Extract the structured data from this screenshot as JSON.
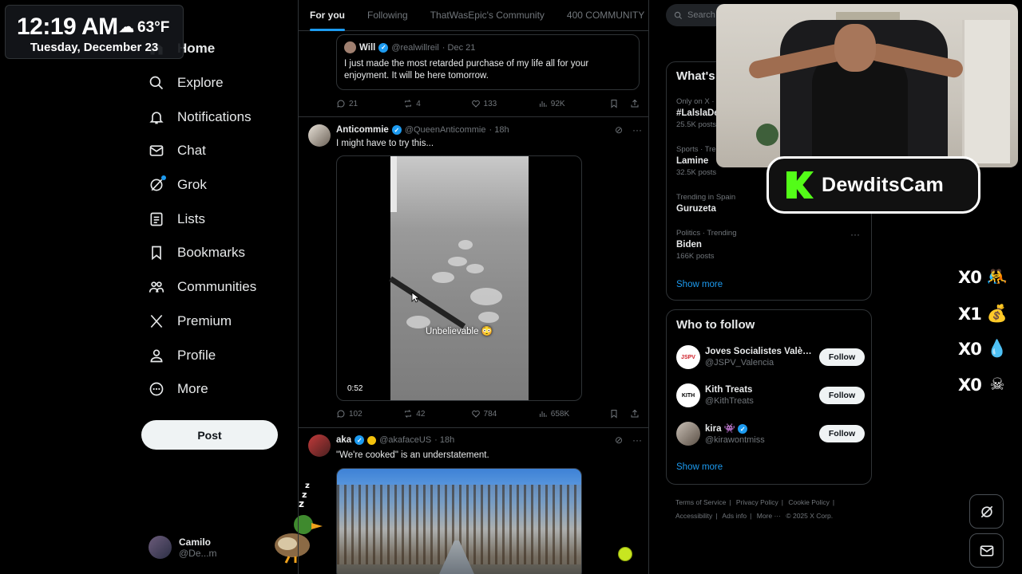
{
  "overlay_clock": {
    "time": "12:19 AM",
    "temperature": "63°F",
    "date": "Tuesday, December 23"
  },
  "nav": {
    "items": [
      {
        "label": "Home",
        "icon": "home-icon"
      },
      {
        "label": "Explore",
        "icon": "search-icon"
      },
      {
        "label": "Notifications",
        "icon": "bell-icon"
      },
      {
        "label": "Chat",
        "icon": "mail-icon"
      },
      {
        "label": "Grok",
        "icon": "grok-icon"
      },
      {
        "label": "Lists",
        "icon": "lists-icon"
      },
      {
        "label": "Bookmarks",
        "icon": "bookmark-icon"
      },
      {
        "label": "Communities",
        "icon": "communities-icon"
      },
      {
        "label": "Premium",
        "icon": "x-logo-icon"
      },
      {
        "label": "Profile",
        "icon": "person-icon"
      },
      {
        "label": "More",
        "icon": "more-circle-icon"
      }
    ],
    "post_button": "Post",
    "account": {
      "name": "Camilo",
      "handle": "@De...m"
    }
  },
  "feed": {
    "tabs": [
      "For you",
      "Following",
      "ThatWasEpic's Community",
      "400 COMMUNITY"
    ],
    "quote": {
      "name": "Will",
      "handle": "@realwillreil",
      "date": "· Dec 21",
      "text": "I just made the most retarded purchase of my life all for your enjoyment. It will be here tomorrow."
    },
    "quote_actions": {
      "replies": "21",
      "reposts": "4",
      "likes": "133",
      "views": "92K"
    },
    "tweet1": {
      "name": "Anticommie",
      "handle": "@QueenAnticommie",
      "time": "· 18h",
      "text": "I might have to try this...",
      "video_caption": "Unbelievable 😳",
      "video_duration": "0:52"
    },
    "tweet1_actions": {
      "replies": "102",
      "reposts": "42",
      "likes": "784",
      "views": "658K"
    },
    "tweet2": {
      "name": "aka",
      "handle": "@akafaceUS",
      "time": "· 18h",
      "text": "\"We're cooked\" is an understatement."
    }
  },
  "right": {
    "search_placeholder": "Search",
    "trends_title": "What's",
    "trends": [
      {
        "context": "Only on X · ",
        "name": "#LalslaDe",
        "count": "25.5K posts"
      },
      {
        "context": "Sports · Tre",
        "name": "Lamine",
        "count": "32.5K posts"
      },
      {
        "context": "Trending in Spain",
        "name": "Guruzeta",
        "count": ""
      },
      {
        "context": "Politics · Trending",
        "name": "Biden",
        "count": "166K posts"
      }
    ],
    "trends_show_more": "Show more",
    "wtf_title": "Who to follow",
    "wtf": [
      {
        "name": "Joves Socialistes Valèn...",
        "handle": "@JSPV_Valencia",
        "button": "Follow"
      },
      {
        "name": "Kith Treats",
        "handle": "@KithTreats",
        "button": "Follow"
      },
      {
        "name": "kira 👾",
        "handle": "@kirawontmiss",
        "button": "Follow"
      }
    ],
    "wtf_show_more": "Show more",
    "footer": [
      "Terms of Service",
      "|",
      "Privacy Policy",
      "|",
      "Cookie Policy",
      "|",
      "Accessibility",
      "|",
      "Ads info",
      "|",
      "More ···",
      "© 2025 X Corp."
    ]
  },
  "stream": {
    "cam_label": "DewditsCam",
    "counters": [
      {
        "value": "X0",
        "icon": "wrestling-icon"
      },
      {
        "value": "X1",
        "icon": "money-bag-icon"
      },
      {
        "value": "X0",
        "icon": "droplets-icon"
      },
      {
        "value": "X0",
        "icon": "skull-icon"
      }
    ]
  },
  "colors": {
    "accent": "#1d9bf0",
    "kick_green": "#53fc18",
    "background": "#000000"
  }
}
